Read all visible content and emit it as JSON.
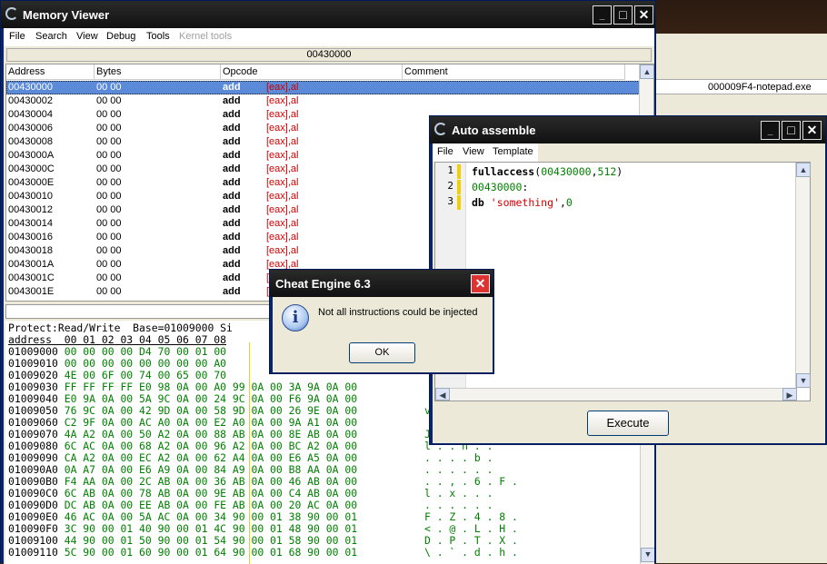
{
  "background_window": {
    "process_label": "000009F4-notepad.exe"
  },
  "memory_viewer": {
    "title": "Memory Viewer",
    "menu": [
      "File",
      "Search",
      "View",
      "Debug",
      "Tools",
      "Kernel tools"
    ],
    "address_bar": "00430000",
    "columns": [
      "Address",
      "Bytes",
      "Opcode",
      "Comment"
    ],
    "rows": [
      {
        "address": "00430000",
        "bytes": "00 00",
        "op": "add",
        "args": "[eax],al"
      },
      {
        "address": "00430002",
        "bytes": "00 00",
        "op": "add",
        "args": "[eax],al"
      },
      {
        "address": "00430004",
        "bytes": "00 00",
        "op": "add",
        "args": "[eax],al"
      },
      {
        "address": "00430006",
        "bytes": "00 00",
        "op": "add",
        "args": "[eax],al"
      },
      {
        "address": "00430008",
        "bytes": "00 00",
        "op": "add",
        "args": "[eax],al"
      },
      {
        "address": "0043000A",
        "bytes": "00 00",
        "op": "add",
        "args": "[eax],al"
      },
      {
        "address": "0043000C",
        "bytes": "00 00",
        "op": "add",
        "args": "[eax],al"
      },
      {
        "address": "0043000E",
        "bytes": "00 00",
        "op": "add",
        "args": "[eax],al"
      },
      {
        "address": "00430010",
        "bytes": "00 00",
        "op": "add",
        "args": "[eax],al"
      },
      {
        "address": "00430012",
        "bytes": "00 00",
        "op": "add",
        "args": "[eax],al"
      },
      {
        "address": "00430014",
        "bytes": "00 00",
        "op": "add",
        "args": "[eax],al"
      },
      {
        "address": "00430016",
        "bytes": "00 00",
        "op": "add",
        "args": "[eax],al"
      },
      {
        "address": "00430018",
        "bytes": "00 00",
        "op": "add",
        "args": "[eax],al"
      },
      {
        "address": "0043001A",
        "bytes": "00 00",
        "op": "add",
        "args": "[eax],al"
      },
      {
        "address": "0043001C",
        "bytes": "00 00",
        "op": "add",
        "args": "[eax],al"
      },
      {
        "address": "0043001E",
        "bytes": "00 00",
        "op": "add",
        "args": "[eax],al"
      }
    ],
    "hex_info": "Protect:Read/Write  Base=01009000 Si",
    "hex_header": "address  00 01 02 03 04 05 06 07 08",
    "hex_lines": [
      {
        "addr": "01009000",
        "hex": "00 00 00 00 D4 70 00 01 00",
        "chars": ""
      },
      {
        "addr": "01009010",
        "hex": "00 00 00 00 00 00 00 00 A0",
        "chars": ""
      },
      {
        "addr": "01009020",
        "hex": "4E 00 6F 00 74 00 65 00 70",
        "chars": ""
      },
      {
        "addr": "01009030",
        "hex": "FF FF FF FF E0 98 0A 00 A0 99 0A 00 3A 9A 0A 00",
        "chars": ""
      },
      {
        "addr": "01009040",
        "hex": "E0 9A 0A 00 5A 9C 0A 00 24 9C 0A 00 F6 9A 0A 00",
        "chars": ""
      },
      {
        "addr": "01009050",
        "hex": "76 9C 0A 00 42 9D 0A 00 58 9D 0A 00 26 9E 0A 00",
        "chars": "v"
      },
      {
        "addr": "01009060",
        "hex": "C2 9F 0A 00 AC A0 0A 00 E2 A0 0A 00 9A A1 0A 00",
        "chars": ""
      },
      {
        "addr": "01009070",
        "hex": "4A A2 0A 00 50 A2 0A 00 88 AB 0A 00 8E AB 0A 00",
        "chars": "J"
      },
      {
        "addr": "01009080",
        "hex": "6C AC 0A 00 68 A2 0A 00 96 A2 0A 00 BC A2 0A 00",
        "chars": "l . . h . ."
      },
      {
        "addr": "01009090",
        "hex": "CA A2 0A 00 EC A2 0A 00 62 A4 0A 00 E6 A5 0A 00",
        "chars": ". . . . b ."
      },
      {
        "addr": "010090A0",
        "hex": "0A A7 0A 00 E6 A9 0A 00 84 A9 0A 00 B8 AA 0A 00",
        "chars": ". . . . . ."
      },
      {
        "addr": "010090B0",
        "hex": "F4 AA 0A 00 2C AB 0A 00 36 AB 0A 00 46 AB 0A 00",
        "chars": ". . , . 6 . F ."
      },
      {
        "addr": "010090C0",
        "hex": "6C AB 0A 00 78 AB 0A 00 9E AB 0A 00 C4 AB 0A 00",
        "chars": "l . x . . ."
      },
      {
        "addr": "010090D0",
        "hex": "DC AB 0A 00 EE AB 0A 00 FE AB 0A 00 20 AC 0A 00",
        "chars": ". . . . . ."
      },
      {
        "addr": "010090E0",
        "hex": "46 AC 0A 00 5A AC 0A 00 34 90 00 01 38 90 00 01",
        "chars": "F . Z . 4 . 8 ."
      },
      {
        "addr": "010090F0",
        "hex": "3C 90 00 01 40 90 00 01 4C 90 00 01 48 90 00 01",
        "chars": "< . @ . L . H ."
      },
      {
        "addr": "01009100",
        "hex": "44 90 00 01 50 90 00 01 54 90 00 01 58 90 00 01",
        "chars": "D . P . T . X ."
      },
      {
        "addr": "01009110",
        "hex": "5C 90 00 01 60 90 00 01 64 90 00 01 68 90 00 01",
        "chars": "\\ . ` . d . h ."
      }
    ]
  },
  "auto_assemble": {
    "title": "Auto assemble",
    "menu": [
      "File",
      "View",
      "Template"
    ],
    "lines": [
      {
        "num": "1",
        "kw": "fullaccess",
        "p1": "(",
        "n1": "00430000",
        "p2": ",",
        "n2": "512",
        "p3": ")"
      },
      {
        "num": "2",
        "label": "00430000",
        "colon": ":"
      },
      {
        "num": "3",
        "kw": "db",
        "str": "'something'",
        "p": ",",
        "n": "0"
      }
    ],
    "execute_label": "Execute"
  },
  "dialog": {
    "title": "Cheat Engine 6.3",
    "message": "Not all instructions could be injected",
    "ok_label": "OK"
  },
  "colors": {
    "selection": "#5a8ad8",
    "hex_green": "#008000",
    "operand_red": "#d00000",
    "titlebar": "#111111"
  }
}
